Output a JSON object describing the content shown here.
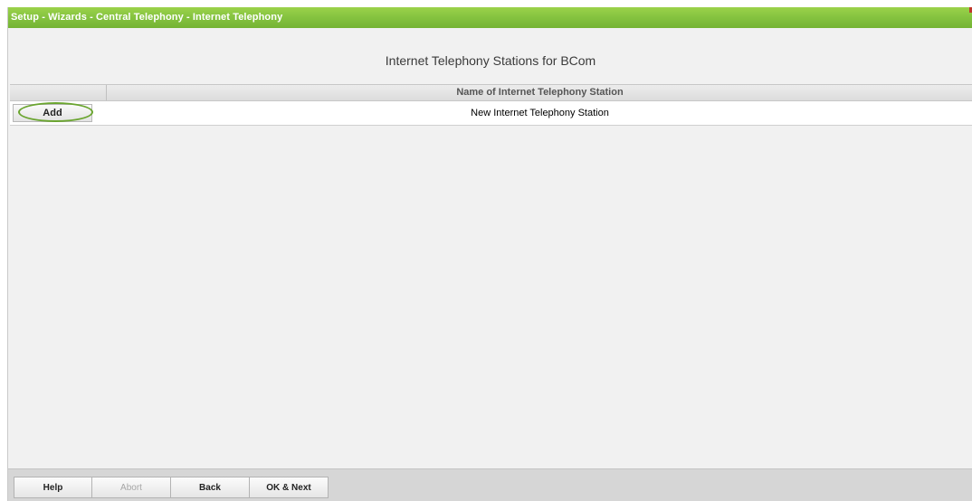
{
  "window": {
    "breadcrumb": "Setup - Wizards - Central Telephony - Internet Telephony"
  },
  "main": {
    "title": "Internet Telephony Stations for BCom",
    "table": {
      "columns": [
        "",
        "Name of Internet Telephony Station"
      ],
      "rows": [
        {
          "action_label": "Add",
          "name": "New Internet Telephony Station"
        }
      ]
    }
  },
  "footer": {
    "buttons": [
      {
        "label": "Help",
        "enabled": true
      },
      {
        "label": "Abort",
        "enabled": false
      },
      {
        "label": "Back",
        "enabled": true
      },
      {
        "label": "OK & Next",
        "enabled": true
      }
    ]
  },
  "colors": {
    "title_bar": "#86c440",
    "highlight_ring": "#6aa52f",
    "background": "#f1f1f1",
    "footer": "#d6d6d6"
  }
}
